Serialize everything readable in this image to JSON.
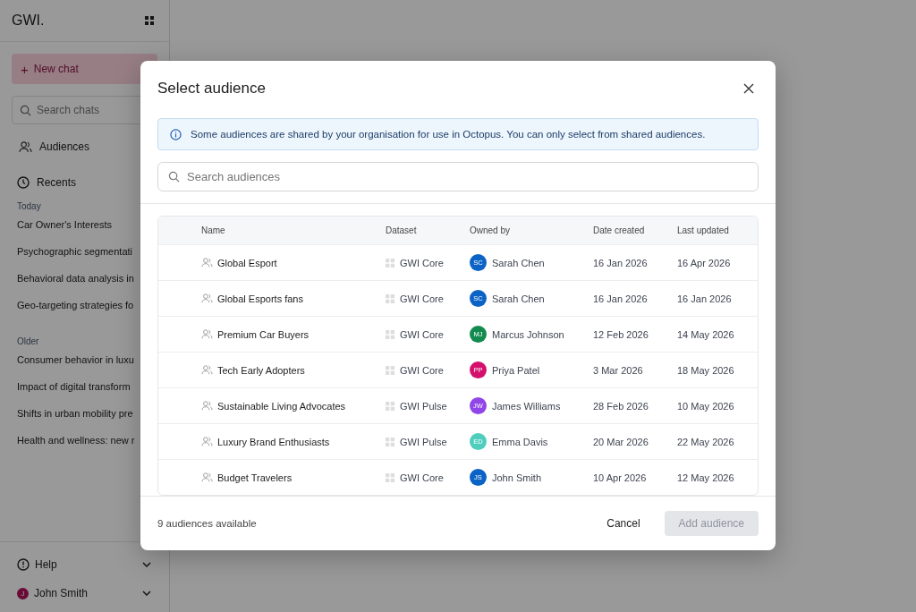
{
  "sidebar": {
    "logo": "GWI.",
    "new_chat": {
      "icon": "+",
      "label": "New chat"
    },
    "search": {
      "placeholder": "Search chats"
    },
    "audiences": "Audiences",
    "recents": "Recents",
    "groups": [
      {
        "label": "Today",
        "items": [
          "Car Owner's Interests",
          "Psychographic segmentati",
          "Behavioral data analysis in",
          "Geo-targeting strategies fo"
        ]
      },
      {
        "label": "Older",
        "items": [
          "Consumer behavior in luxu",
          "Impact of digital transform",
          "Shifts in urban mobility pre",
          "Health and wellness: new r"
        ]
      }
    ],
    "help": "Help",
    "user": {
      "initial": "J",
      "name": "John Smith"
    }
  },
  "dialog": {
    "title": "Select audience",
    "notice": "Some audiences are shared by your organisation for use in Octopus. You can only select from shared audiences.",
    "search": {
      "placeholder": "Search audiences"
    },
    "table": {
      "columns": [
        "Name",
        "Dataset",
        "Owned by",
        "Date created",
        "Last updated"
      ],
      "rows": [
        {
          "name": "Global Esport",
          "dataset": "GWI Core",
          "initials": "SC",
          "owner": "Sarah Chen",
          "color": "#0b63c5",
          "created": "16 Jan 2026",
          "updated": "16 Apr 2026"
        },
        {
          "name": "Global Esports fans",
          "dataset": "GWI Core",
          "initials": "SC",
          "owner": "Sarah Chen",
          "color": "#0b63c5",
          "created": "16 Jan 2026",
          "updated": "16 Jan 2026"
        },
        {
          "name": "Premium Car Buyers",
          "dataset": "GWI Core",
          "initials": "MJ",
          "owner": "Marcus Johnson",
          "color": "#138a4e",
          "created": "12 Feb 2026",
          "updated": "14 May 2026"
        },
        {
          "name": "Tech Early Adopters",
          "dataset": "GWI Core",
          "initials": "PP",
          "owner": "Priya Patel",
          "color": "#d40f6c",
          "created": "3 Mar 2026",
          "updated": "18 May 2026"
        },
        {
          "name": "Sustainable Living Advocates",
          "dataset": "GWI Pulse",
          "initials": "JW",
          "owner": "James Williams",
          "color": "#8f45e8",
          "created": "28 Feb 2026",
          "updated": "10 May 2026"
        },
        {
          "name": "Luxury Brand Enthusiasts",
          "dataset": "GWI Pulse",
          "initials": "ED",
          "owner": "Emma Davis",
          "color": "#4fcdbd",
          "created": "20 Mar 2026",
          "updated": "22 May 2026"
        },
        {
          "name": "Budget Travelers",
          "dataset": "GWI Core",
          "initials": "JS",
          "owner": "John Smith",
          "color": "#0b63c5",
          "created": "10 Apr 2026",
          "updated": "12 May 2026"
        }
      ]
    },
    "count": "9 audiences available",
    "cancel": "Cancel",
    "add": {
      "label": "Add audience",
      "disabled": true
    }
  }
}
